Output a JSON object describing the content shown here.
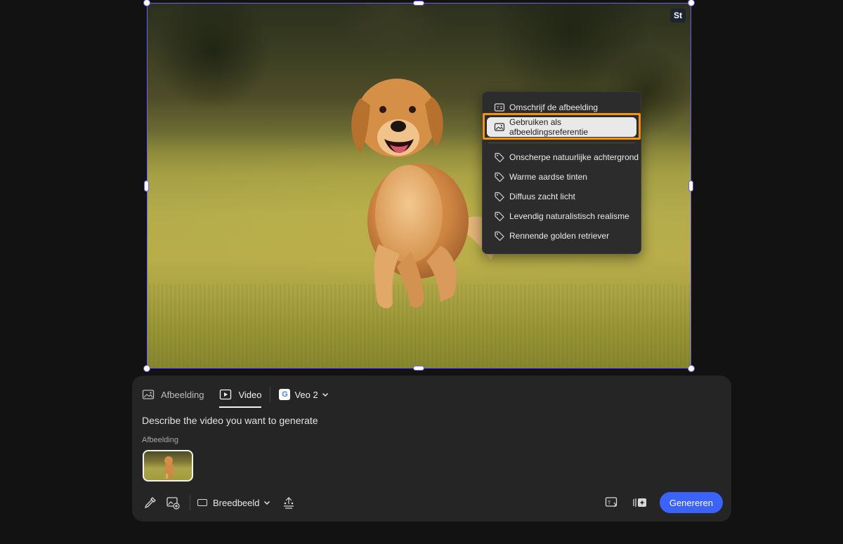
{
  "canvas": {
    "stock_badge": "St",
    "image_subject": "dog"
  },
  "context_menu": {
    "actions": [
      {
        "label": "Omschrijf de afbeelding",
        "icon": "describe-icon"
      },
      {
        "label": "Gebruiken als afbeeldingsreferentie",
        "icon": "image-icon",
        "active": true
      }
    ],
    "tags": [
      {
        "label": "Onscherpe natuurlijke achtergrond",
        "icon": "tag-icon"
      },
      {
        "label": "Warme aardse tinten",
        "icon": "tag-icon"
      },
      {
        "label": "Diffuus zacht licht",
        "icon": "tag-icon"
      },
      {
        "label": "Levendig naturalistisch realisme",
        "icon": "tag-icon"
      },
      {
        "label": "Rennende golden retriever",
        "icon": "tag-icon"
      }
    ],
    "highlight_color": "#f5930f"
  },
  "prompt_panel": {
    "tabs": [
      {
        "label": "Afbeelding",
        "icon": "image-icon",
        "selected": false
      },
      {
        "label": "Video",
        "icon": "video-play-icon",
        "selected": true
      }
    ],
    "model": {
      "label": "Veo 2",
      "logo": "G"
    },
    "prompt_placeholder": "Describe the video you want to generate",
    "reference_label": "Afbeelding",
    "aspect": "Breedbeeld",
    "generate_label": "Genereren",
    "accent_color": "#3b63fb"
  }
}
